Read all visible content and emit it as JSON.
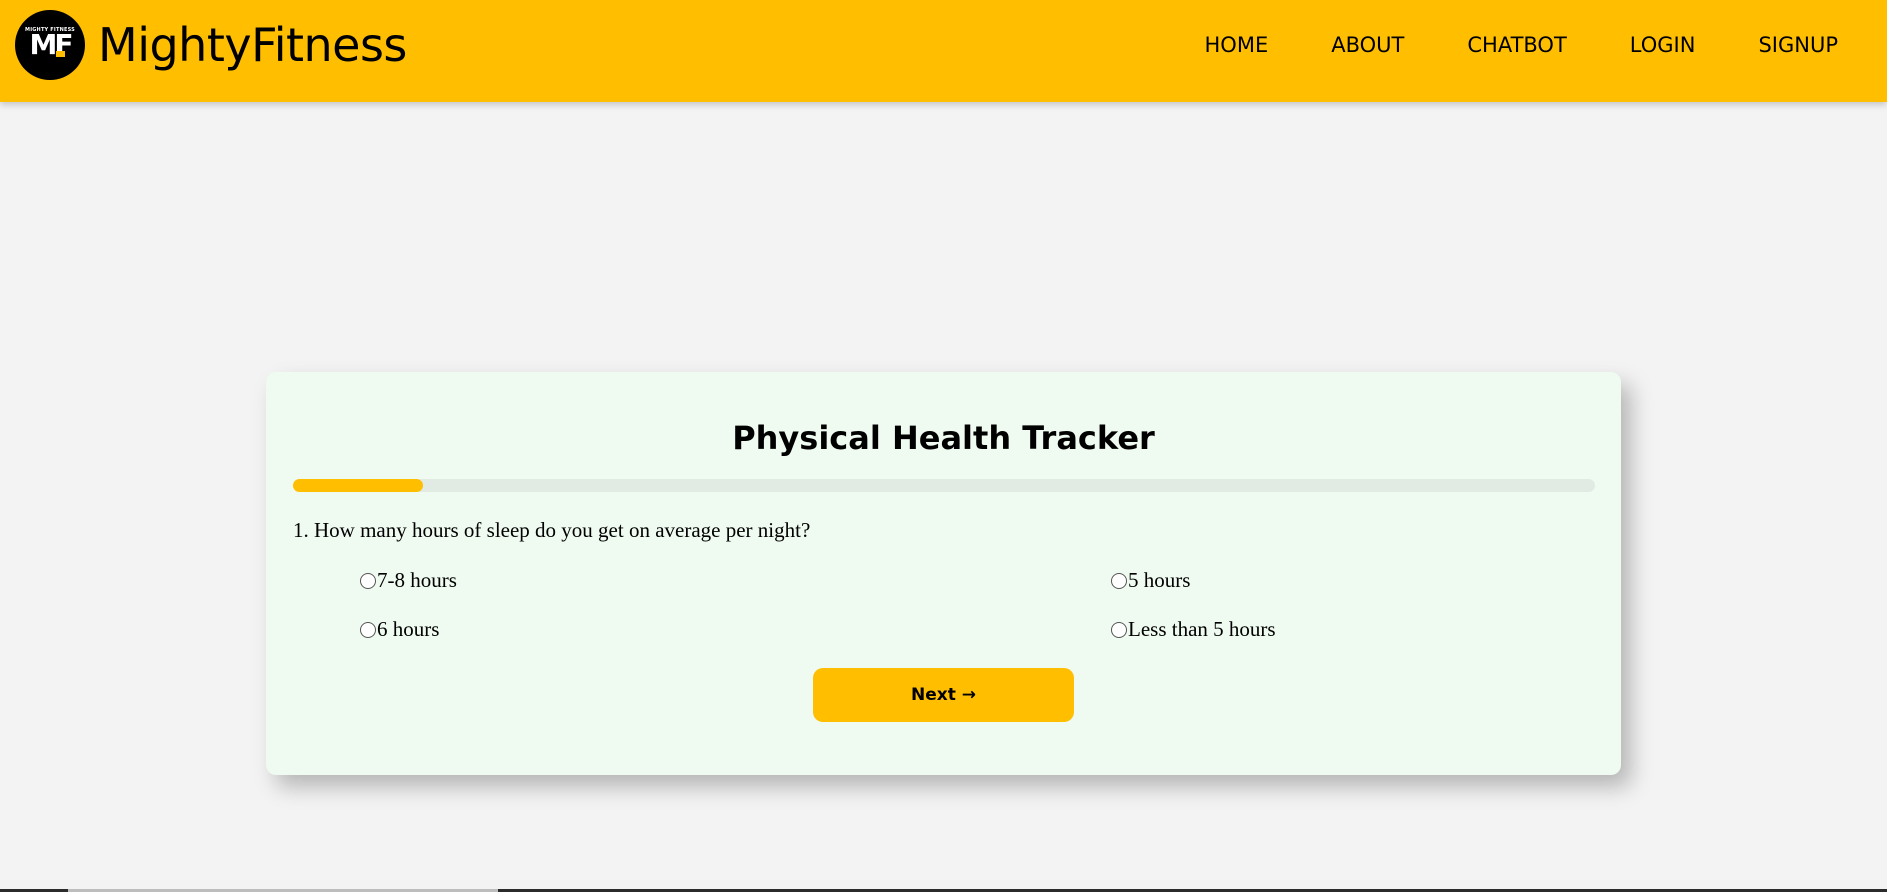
{
  "brand": {
    "name": "MightyFitness",
    "logo_small_text": "MIGHTY FITNESS",
    "logo_text": "MF"
  },
  "nav": {
    "items": [
      {
        "label": "HOME"
      },
      {
        "label": "ABOUT"
      },
      {
        "label": "CHATBOT"
      },
      {
        "label": "LOGIN"
      },
      {
        "label": "SIGNUP"
      }
    ]
  },
  "tracker": {
    "title": "Physical Health Tracker",
    "progress_fraction": 0.1,
    "question": "1. How many hours of sleep do you get on average per night?",
    "options": [
      {
        "label": "7-8 hours",
        "selected": false
      },
      {
        "label": "5 hours",
        "selected": false
      },
      {
        "label": "6 hours",
        "selected": false
      },
      {
        "label": "Less than 5 hours",
        "selected": false
      }
    ],
    "next_label": "Next →"
  },
  "colors": {
    "accent": "#ffbf00",
    "page_background": "#f3f3f3",
    "card_background": "#effaf1"
  }
}
